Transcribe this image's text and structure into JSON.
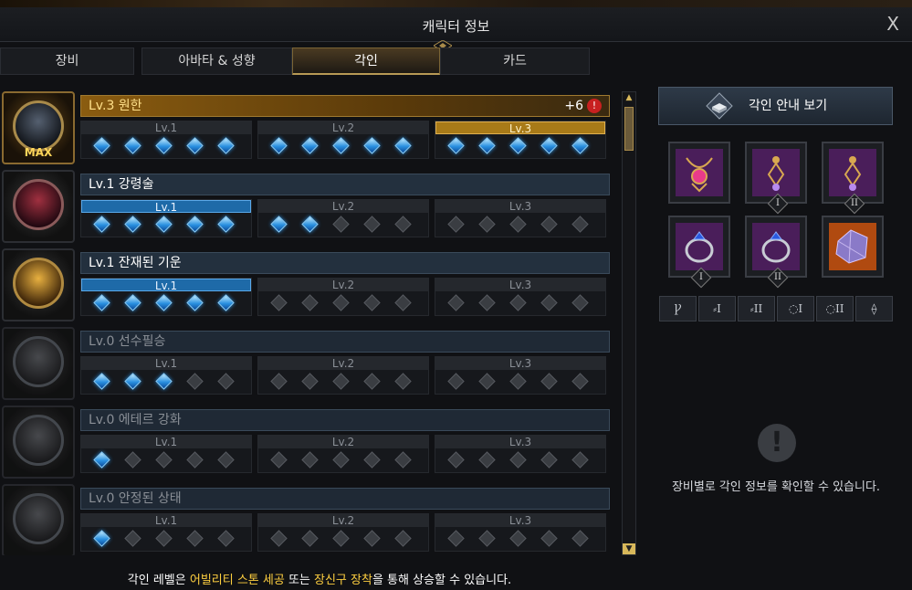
{
  "window": {
    "title": "캐릭터 정보",
    "close_label": "X"
  },
  "tabs": [
    {
      "label": "장비",
      "active": false
    },
    {
      "label": "아바타 & 성향",
      "active": false
    },
    {
      "label": "각인",
      "active": true
    },
    {
      "label": "카드",
      "active": false
    }
  ],
  "engravings": [
    {
      "name": "Lv.3 원한",
      "bonus": "+6",
      "badge": "MAX",
      "levels": [
        {
          "label": "Lv.1",
          "state": "normal",
          "filled": 5
        },
        {
          "label": "Lv.2",
          "state": "normal",
          "filled": 5
        },
        {
          "label": "Lv.3",
          "state": "gold",
          "filled": 5
        }
      ]
    },
    {
      "name": "Lv.1 강령술",
      "levels": [
        {
          "label": "Lv.1",
          "state": "blue",
          "filled": 5
        },
        {
          "label": "Lv.2",
          "state": "normal",
          "filled": 2
        },
        {
          "label": "Lv.3",
          "state": "normal",
          "filled": 0
        }
      ]
    },
    {
      "name": "Lv.1 잔재된 기운",
      "levels": [
        {
          "label": "Lv.1",
          "state": "blue",
          "filled": 5
        },
        {
          "label": "Lv.2",
          "state": "normal",
          "filled": 0
        },
        {
          "label": "Lv.3",
          "state": "normal",
          "filled": 0
        }
      ]
    },
    {
      "name": "Lv.0 선수필승",
      "levels": [
        {
          "label": "Lv.1",
          "state": "normal",
          "filled": 3
        },
        {
          "label": "Lv.2",
          "state": "normal",
          "filled": 0
        },
        {
          "label": "Lv.3",
          "state": "normal",
          "filled": 0
        }
      ]
    },
    {
      "name": "Lv.0 에테르 강화",
      "levels": [
        {
          "label": "Lv.1",
          "state": "normal",
          "filled": 1
        },
        {
          "label": "Lv.2",
          "state": "normal",
          "filled": 0
        },
        {
          "label": "Lv.3",
          "state": "normal",
          "filled": 0
        }
      ]
    },
    {
      "name": "Lv.0 안정된 상태",
      "levels": [
        {
          "label": "Lv.1",
          "state": "normal",
          "filled": 1
        },
        {
          "label": "Lv.2",
          "state": "normal",
          "filled": 0
        },
        {
          "label": "Lv.3",
          "state": "normal",
          "filled": 0
        }
      ]
    }
  ],
  "guide_button": {
    "label": "각인 안내 보기",
    "icon": "book-icon"
  },
  "accessory_slots": [
    {
      "icon": "necklace-icon",
      "roman": ""
    },
    {
      "icon": "earring-icon",
      "roman": "I"
    },
    {
      "icon": "earring-icon",
      "roman": "II"
    },
    {
      "icon": "ring-icon",
      "roman": "I"
    },
    {
      "icon": "ring-icon",
      "roman": "II"
    },
    {
      "icon": "ability-stone-icon",
      "roman": ""
    }
  ],
  "filter_buttons": [
    {
      "icon": "necklace-filter-icon",
      "roman": ""
    },
    {
      "icon": "earring-filter-icon",
      "roman": "I"
    },
    {
      "icon": "earring-filter-icon",
      "roman": "II"
    },
    {
      "icon": "ring-filter-icon",
      "roman": "I"
    },
    {
      "icon": "ring-filter-icon",
      "roman": "II"
    },
    {
      "icon": "stone-filter-icon",
      "roman": ""
    }
  ],
  "info": {
    "icon": "exclamation-icon",
    "text": "장비별로 각인 정보를 확인할 수 있습니다."
  },
  "footer": {
    "part1": "각인 레벨은 ",
    "highlight1": "어빌리티 스톤 세공",
    "part2": " 또는 ",
    "highlight2": "장신구 장착",
    "part3": "을 통해 상승할 수 있습니다."
  },
  "colors": {
    "gold": "#ffd040",
    "blue_level": "#1e6aa8",
    "gem_on": "#2a90e0",
    "panel": "#101114"
  }
}
